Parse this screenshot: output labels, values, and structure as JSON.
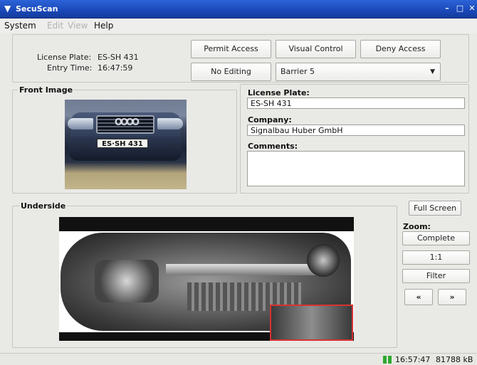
{
  "window": {
    "title": "SecuScan"
  },
  "menu": [
    "System",
    "Edit",
    "View",
    "Help"
  ],
  "info": {
    "plate_label": "License Plate:",
    "plate_value": "ES-SH 431",
    "time_label": "Entry Time:",
    "time_value": "16:47:59"
  },
  "actions": {
    "permit": "Permit Access",
    "visual": "Visual Control",
    "deny": "Deny Access",
    "no_edit": "No Editing",
    "barrier": "Barrier 5"
  },
  "front": {
    "title": "Front Image",
    "plate_on_car": "ES·SH 431",
    "brand_rings": "OOOO"
  },
  "details": {
    "plate_label": "License Plate:",
    "plate_value": "ES-SH 431",
    "company_label": "Company:",
    "company_value": "Signalbau Huber GmbH",
    "comments_label": "Comments:",
    "comments_value": ""
  },
  "underside": {
    "title": "Underside"
  },
  "side": {
    "fullscreen": "Full Screen",
    "zoom_label": "Zoom:",
    "complete": "Complete",
    "one_to_one": "1:1",
    "filter": "Filter",
    "prev": "«",
    "next": "»"
  },
  "status": {
    "time": "16:57:47",
    "memory": "81788 kB"
  }
}
